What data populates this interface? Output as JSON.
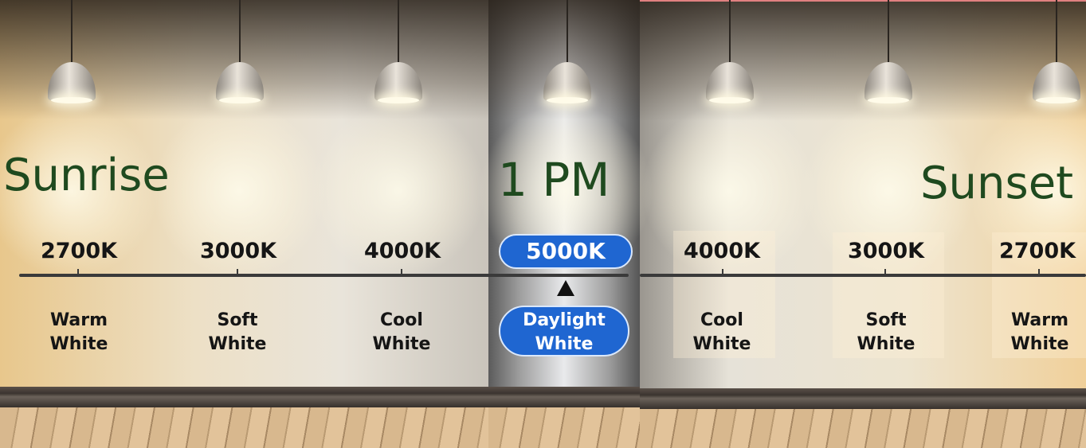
{
  "headings": {
    "sunrise": "Sunrise",
    "midday": "1 PM",
    "sunset": "Sunset"
  },
  "colors": {
    "heading_green": "#1f4a1f",
    "pill_blue": "#1f66d1"
  },
  "temperatures": [
    "2700K",
    "3000K",
    "4000K",
    "5000K",
    "4000K",
    "3000K",
    "2700K"
  ],
  "descriptions": [
    {
      "line1": "Warm",
      "line2": "White"
    },
    {
      "line1": "Soft",
      "line2": "White"
    },
    {
      "line1": "Cool",
      "line2": "White"
    },
    {
      "line1": "Daylight",
      "line2": "White"
    },
    {
      "line1": "Cool",
      "line2": "White"
    },
    {
      "line1": "Soft",
      "line2": "White"
    },
    {
      "line1": "Warm",
      "line2": "White"
    }
  ]
}
